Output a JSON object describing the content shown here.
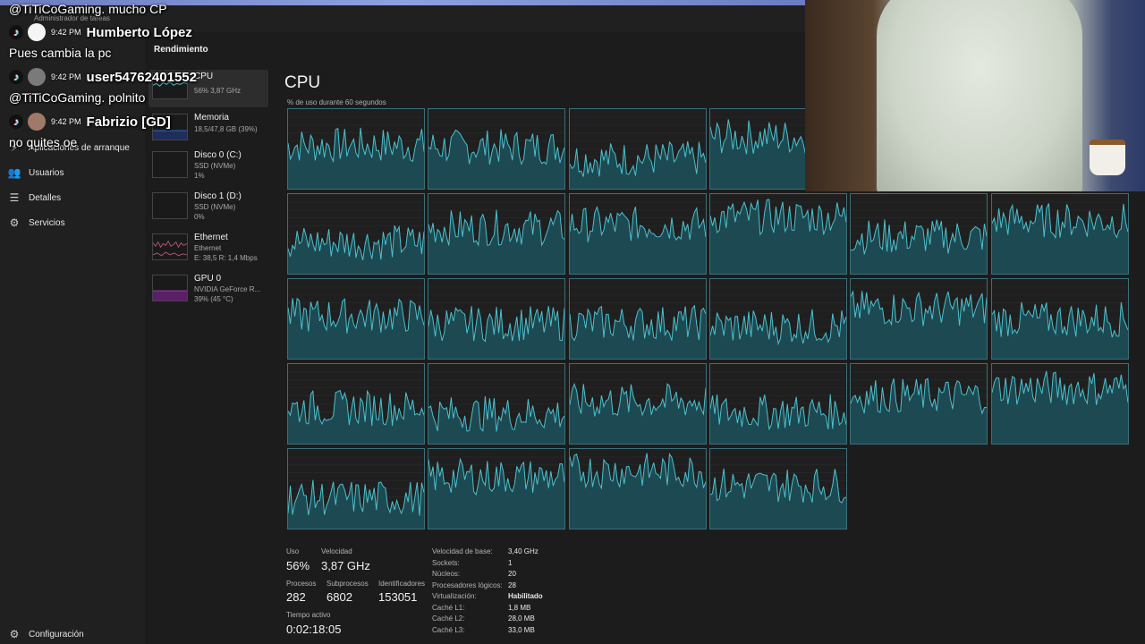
{
  "app": {
    "title": "Administrador de tareas"
  },
  "sidebar": {
    "items": [
      {
        "label": "Aplicaciones de arranque",
        "icon": "startup-icon"
      },
      {
        "label": "Usuarios",
        "icon": "users-icon"
      },
      {
        "label": "Detalles",
        "icon": "details-icon"
      },
      {
        "label": "Servicios",
        "icon": "services-icon"
      }
    ],
    "settings_label": "Configuración"
  },
  "panel": {
    "title": "Rendimiento",
    "resources": [
      {
        "name": "CPU",
        "detail": "56% 3,87 GHz",
        "color": "#4cc2d0"
      },
      {
        "name": "Memoria",
        "detail": "18,5/47,8 GB (39%)",
        "color": "#3b6fd6"
      },
      {
        "name": "Disco 0 (C:)",
        "detail": "SSD (NVMe)",
        "detail2": "1%",
        "color": "#6aaa3a"
      },
      {
        "name": "Disco 1 (D:)",
        "detail": "SSD (NVMe)",
        "detail2": "0%",
        "color": "#6aaa3a"
      },
      {
        "name": "Ethernet",
        "detail": "Ethernet",
        "detail2": "E: 38,5 R: 1,4 Mbps",
        "color": "#b0567a"
      },
      {
        "name": "GPU 0",
        "detail": "NVIDIA GeForce R...",
        "detail2": "39% (45 °C)",
        "color": "#a23bb0"
      }
    ]
  },
  "cpu": {
    "title": "CPU",
    "caption": "% de uso durante 60 segundos",
    "logical_processors_shown": 28,
    "usage_label": "Uso",
    "usage_value": "56%",
    "speed_label": "Velocidad",
    "speed_value": "3,87 GHz",
    "procs_label": "Procesos",
    "procs_value": "282",
    "threads_label": "Subprocesos",
    "threads_value": "6802",
    "handles_label": "Identificadores",
    "handles_value": "153051",
    "uptime_label": "Tiempo activo",
    "uptime_value": "0:02:18:05",
    "specs": [
      {
        "k": "Velocidad de base:",
        "v": "3,40 GHz"
      },
      {
        "k": "Sockets:",
        "v": "1"
      },
      {
        "k": "Núcleos:",
        "v": "20"
      },
      {
        "k": "Procesadores lógicos:",
        "v": "28"
      },
      {
        "k": "Virtualización:",
        "v": "Habilitado"
      },
      {
        "k": "Caché L1:",
        "v": "1,8 MB"
      },
      {
        "k": "Caché L2:",
        "v": "28,0 MB"
      },
      {
        "k": "Caché L3:",
        "v": "33,0 MB"
      }
    ],
    "line_color": "#4cc2d0",
    "fill_color": "#1d4a52"
  },
  "chat": {
    "line1": "@TiTiCoGaming. mucho CP",
    "msg1": {
      "time": "9:42 PM",
      "user": "Humberto López",
      "text": "Pues cambia la pc"
    },
    "msg2": {
      "time": "9:42 PM",
      "user": "user54762401552",
      "text": "@TiTiCoGaming. polnito"
    },
    "msg3": {
      "time": "9:42 PM",
      "user": "Fabrizio [GD]",
      "text": "no quites oe"
    },
    "tiktok_icon": "tiktok-icon"
  }
}
